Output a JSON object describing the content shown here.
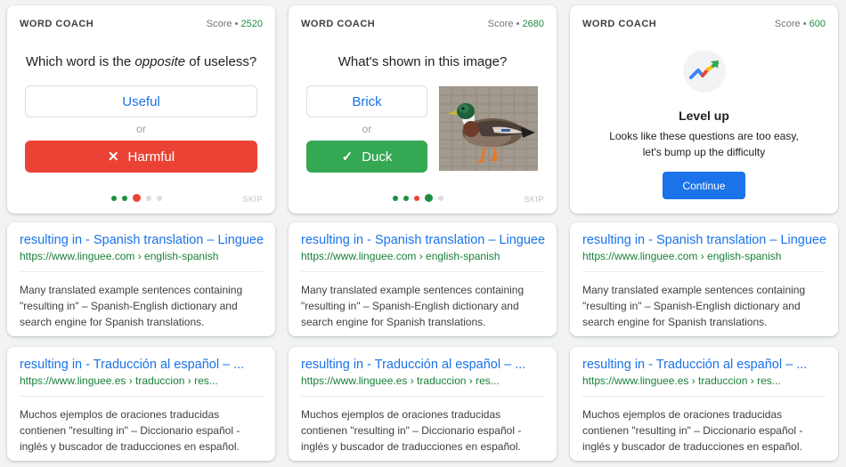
{
  "word_coach": [
    {
      "title": "WORD COACH",
      "score_label": "Score •",
      "score": "2520",
      "question_pre": "Which word is the ",
      "question_em": "opposite",
      "question_post": " of useless?",
      "option_a": "Useful",
      "or": "or",
      "option_b": "Harmful",
      "option_b_mark": "✕",
      "skip": "SKIP",
      "progress_dots": [
        "#1e8e3e",
        "#1e8e3e",
        "#ea4335",
        "#dadce0",
        "#dadce0"
      ],
      "current_dot": 2
    },
    {
      "title": "WORD COACH",
      "score_label": "Score •",
      "score": "2680",
      "question": "What's shown in this image?",
      "option_a": "Brick",
      "or": "or",
      "option_b": "Duck",
      "option_b_mark": "✓",
      "skip": "SKIP",
      "progress_dots": [
        "#1e8e3e",
        "#1e8e3e",
        "#ea4335",
        "#1e8e3e",
        "#dadce0"
      ],
      "current_dot": 3
    },
    {
      "title": "WORD COACH",
      "score_label": "Score •",
      "score": "600",
      "level_title": "Level up",
      "level_text_1": "Looks like these questions are too easy,",
      "level_text_2": "let's bump up the difficulty",
      "continue": "Continue"
    }
  ],
  "results_row1": {
    "title": "resulting in - Spanish translation – Linguee",
    "url": "https://www.linguee.com › english-spanish",
    "snippet": "Many translated example sentences containing \"resulting in\" – Spanish-English dictionary and search engine for Spanish translations."
  },
  "results_row2": {
    "title": "resulting in - Traducción al español – ...",
    "url": "https://www.linguee.es › traduccion › res...",
    "snippet": "Muchos ejemplos de oraciones traducidas contienen \"resulting in\" – Diccionario español - inglés y buscador de traducciones en español."
  },
  "colors": {
    "accent_blue": "#1a73e8",
    "correct_green": "#34a853",
    "wrong_red": "#ea4335",
    "url_green": "#188038"
  }
}
